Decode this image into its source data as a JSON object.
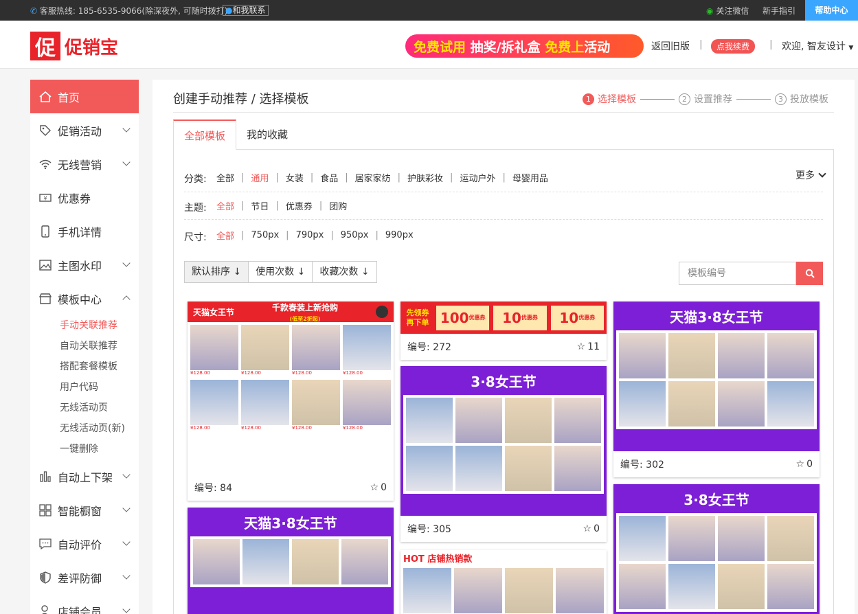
{
  "topbar": {
    "hotline": "客服热线: 185-6535-9066(除深夜外, 可随时拨打)",
    "contact": "和我联系",
    "wechat": "关注微信",
    "guide": "新手指引",
    "help": "帮助中心"
  },
  "header": {
    "logo_mark": "促",
    "logo_text": "促销宝",
    "promo_a": "免费试用",
    "promo_b": "抽奖/拆礼盒",
    "promo_c": "免费上",
    "promo_d": "活动",
    "old_version": "返回旧版",
    "sep": "|",
    "renew": "点我续费",
    "welcome": "欢迎, 智友设计"
  },
  "sidebar": {
    "items": [
      {
        "label": "首页"
      },
      {
        "label": "促销活动"
      },
      {
        "label": "无线营销"
      },
      {
        "label": "优惠券"
      },
      {
        "label": "手机详情"
      },
      {
        "label": "主图水印"
      },
      {
        "label": "模板中心"
      },
      {
        "label": "自动上下架"
      },
      {
        "label": "智能橱窗"
      },
      {
        "label": "自动评价"
      },
      {
        "label": "差评防御"
      },
      {
        "label": "店铺会员"
      }
    ],
    "subitems": [
      {
        "label": "手动关联推荐"
      },
      {
        "label": "自动关联推荐"
      },
      {
        "label": "搭配套餐模板"
      },
      {
        "label": "用户代码"
      },
      {
        "label": "无线活动页"
      },
      {
        "label": "无线活动页(新)"
      },
      {
        "label": "一键删除"
      }
    ]
  },
  "main": {
    "title": "创建手动推荐 / 选择模板",
    "steps": [
      {
        "num": "1",
        "label": "选择模板"
      },
      {
        "num": "2",
        "label": "设置推荐"
      },
      {
        "num": "3",
        "label": "投放模板"
      }
    ],
    "tabs": [
      {
        "label": "全部模板"
      },
      {
        "label": "我的收藏"
      }
    ],
    "filters": {
      "category_label": "分类:",
      "categories": [
        "全部",
        "通用",
        "女装",
        "食品",
        "居家家纺",
        "护肤彩妆",
        "运动户外",
        "母婴用品"
      ],
      "more": "更多",
      "theme_label": "主题:",
      "themes": [
        "全部",
        "节日",
        "优惠券",
        "团购"
      ],
      "size_label": "尺寸:",
      "sizes": [
        "全部",
        "750px",
        "790px",
        "950px",
        "990px"
      ]
    },
    "sort": [
      "默认排序",
      "使用次数",
      "收藏次数"
    ],
    "search": {
      "placeholder": "模板编号"
    },
    "cards": [
      {
        "id": "编号: 84",
        "fav": "0",
        "banner_left": "天猫女王节",
        "banner_mid": "千款春装上新抢购",
        "banner_sub": "(低至2折起)",
        "price": "¥128.00"
      },
      {
        "id": "编号: 272",
        "fav": "11",
        "coupon_left": "先领券",
        "coupon_left2": "再下单",
        "coupon1": "100",
        "coupon2": "10",
        "coupon3": "10",
        "coupon_unit": "优惠券"
      },
      {
        "id": "编号: 302",
        "fav": "0",
        "banner": "天猫3·8女王节"
      },
      {
        "id": "编号: 305",
        "fav": "0",
        "banner": "3·8女王节"
      },
      {
        "id": "",
        "fav": "",
        "banner": "天猫3·8女王节"
      },
      {
        "id": "",
        "fav": "",
        "banner": "HOT 店铺热销款"
      },
      {
        "id": "",
        "fav": "",
        "banner": "3·8女王节"
      }
    ]
  },
  "colors": {
    "accent": "#f25a5a",
    "brand": "#e8232a",
    "help_blue": "#3ba6ff",
    "purple": "#7d1fd6"
  }
}
